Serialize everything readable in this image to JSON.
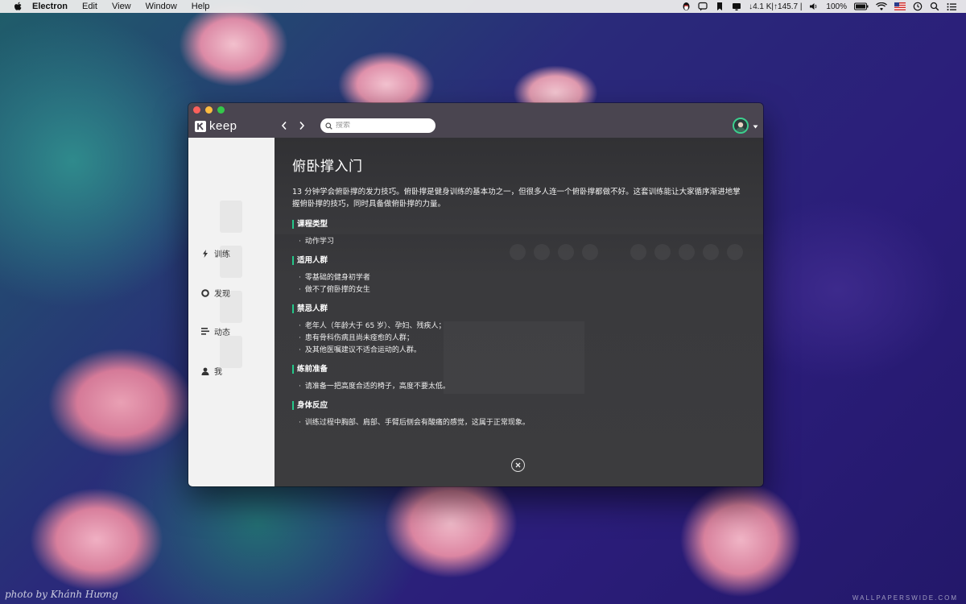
{
  "menubar": {
    "apple_icon": "apple-logo-icon",
    "app_name": "Electron",
    "items": [
      "Edit",
      "View",
      "Window",
      "Help"
    ],
    "network_stats": "↓4.1 K|↑145.7 |",
    "battery": "100%"
  },
  "app": {
    "logo_text": "keep",
    "search_placeholder": "搜索",
    "accent_color": "#24c789"
  },
  "sidebar": {
    "items": [
      {
        "label": "训练",
        "icon": "lightning-icon"
      },
      {
        "label": "发现",
        "icon": "circle-icon"
      },
      {
        "label": "动态",
        "icon": "list-icon"
      },
      {
        "label": "我",
        "icon": "person-icon"
      }
    ]
  },
  "course": {
    "title": "俯卧撑入门",
    "description": "13 分钟学会俯卧撑的发力技巧。俯卧撑是健身训练的基本功之一，但很多人连一个俯卧撑都做不好。这套训练能让大家循序渐进地掌握俯卧撑的技巧，同时具备做俯卧撑的力量。",
    "sections": [
      {
        "heading": "课程类型",
        "items": [
          "动作学习"
        ]
      },
      {
        "heading": "适用人群",
        "items": [
          "零基础的健身初学者",
          "做不了俯卧撑的女生"
        ]
      },
      {
        "heading": "禁忌人群",
        "items": [
          "老年人（年龄大于 65 岁）、孕妇、残疾人；",
          "患有骨科伤病且尚未痊愈的人群；",
          "及其他医嘱建议不适合运动的人群。"
        ]
      },
      {
        "heading": "练前准备",
        "items": [
          "请准备一把高度合适的椅子，高度不要太低。"
        ]
      },
      {
        "heading": "身体反应",
        "items": [
          "训练过程中胸部、肩部、手臂后侧会有酸痛的感觉，这属于正常现象。"
        ]
      }
    ]
  },
  "wallpaper": {
    "credit": "photo by Khánh Hương",
    "brand": "WALLPAPERSWIDE.COM"
  }
}
